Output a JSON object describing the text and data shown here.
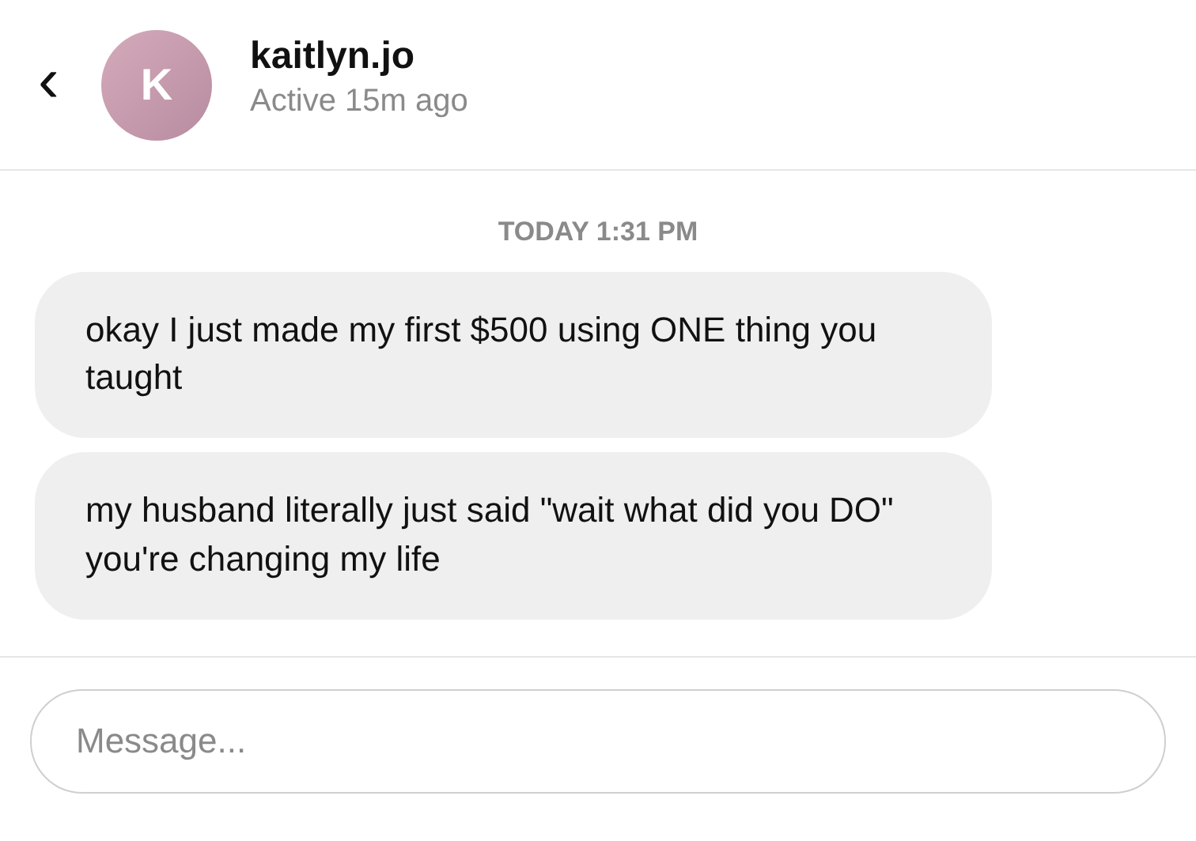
{
  "header": {
    "back": "‹",
    "avatar_letter": "K",
    "name": "kaitlyn.jo",
    "status": "Active 15m ago"
  },
  "timestamp": "TODAY 1:31 PM",
  "messages": [
    {
      "text": "okay I just made my first $500 using ONE thing you taught"
    },
    {
      "text": "my husband literally just said \"wait what did you DO\" you're changing my life"
    }
  ],
  "composer": {
    "placeholder": "Message..."
  }
}
